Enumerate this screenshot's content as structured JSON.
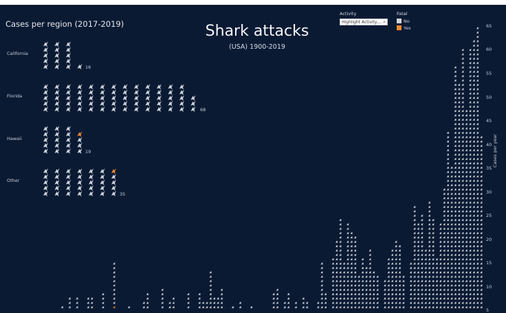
{
  "header": {
    "title": "Shark attacks",
    "subtitle": "(USA) 1900-2019",
    "region_title": "Cases per region (2017-2019)"
  },
  "filters": {
    "activity_label": "Activity",
    "activity_value": "Highlight Activity,...",
    "fatal_label": "Fatal",
    "legend": [
      {
        "label": "No",
        "color": "#cfd5dd"
      },
      {
        "label": "Yes",
        "color": "#f08a2c"
      }
    ]
  },
  "colors": {
    "background": "#0b1a33",
    "non_fatal": "#cfd5dd",
    "fatal": "#f08a2c"
  },
  "chart_data": [
    {
      "type": "bar",
      "title": "Cases per region (2017-2019)",
      "categories": [
        "California",
        "Florida",
        "Hawaii",
        "Other"
      ],
      "values": [
        16,
        68,
        19,
        35
      ],
      "fatal": [
        0,
        0,
        1,
        1
      ],
      "icons_per_column": 5
    },
    {
      "type": "bar",
      "title": "Shark attacks",
      "subtitle": "(USA) 1900-2019",
      "ylabel": "Cases per year",
      "ylim": [
        0,
        65
      ],
      "yticks": [
        65,
        60,
        55,
        50,
        45,
        40,
        35,
        30,
        25,
        20,
        15,
        10,
        5
      ],
      "grid": false,
      "x_start": 1900,
      "x_end": 2019,
      "values": [
        0,
        0,
        0,
        0,
        0,
        0,
        1,
        0,
        3,
        0,
        3,
        0,
        0,
        3,
        3,
        0,
        0,
        4,
        0,
        0,
        11,
        0,
        0,
        0,
        1,
        0,
        0,
        0,
        2,
        4,
        0,
        0,
        0,
        5,
        0,
        2,
        3,
        0,
        0,
        0,
        4,
        0,
        0,
        4,
        2,
        2,
        9,
        3,
        3,
        5,
        0,
        0,
        1,
        0,
        2,
        0,
        0,
        1,
        0,
        0,
        0,
        0,
        0,
        4,
        5,
        0,
        2,
        4,
        0,
        2,
        0,
        3,
        2,
        0,
        0,
        2,
        11,
        4,
        0,
        12,
        16,
        21,
        11,
        20,
        18,
        17,
        8,
        12,
        10,
        14,
        9,
        8,
        0,
        7,
        12,
        14,
        16,
        15,
        8,
        0,
        11,
        24,
        20,
        22,
        14,
        25,
        21,
        12,
        20,
        28,
        41,
        33,
        56,
        52,
        60,
        46,
        60,
        62,
        65,
        40
      ],
      "fatal": [
        0,
        0,
        0,
        0,
        0,
        0,
        0,
        0,
        0,
        0,
        0,
        0,
        0,
        0,
        0,
        0,
        0,
        0,
        0,
        0,
        1,
        0,
        0,
        0,
        0,
        0,
        0,
        0,
        0,
        0,
        0,
        0,
        0,
        0,
        0,
        0,
        0,
        0,
        0,
        0,
        0,
        0,
        0,
        0,
        0,
        0,
        0,
        0,
        0,
        0,
        0,
        0,
        0,
        0,
        0,
        0,
        0,
        0,
        0,
        0,
        0,
        0,
        0,
        0,
        0,
        0,
        0,
        0,
        0,
        0,
        0,
        0,
        0,
        0,
        0,
        0,
        0,
        0,
        0,
        0,
        0,
        0,
        0,
        0,
        0,
        0,
        0,
        0,
        0,
        0,
        0,
        0,
        0,
        0,
        0,
        0,
        0,
        0,
        0,
        0,
        0,
        0,
        0,
        0,
        0,
        0,
        0,
        0,
        0,
        0,
        0,
        0,
        0,
        0,
        0,
        0,
        0,
        0,
        0,
        0
      ]
    }
  ]
}
